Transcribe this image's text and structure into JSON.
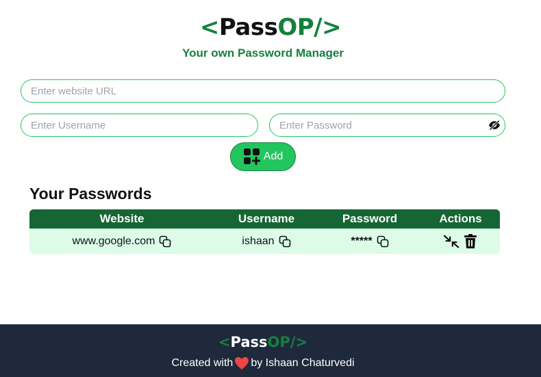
{
  "header": {
    "brand": {
      "lt": "<",
      "pass": "Pass",
      "op": "OP/",
      "gt": ">"
    },
    "tagline": "Your own Password Manager"
  },
  "form": {
    "url_placeholder": "Enter website URL",
    "username_placeholder": "Enter Username",
    "password_placeholder": "Enter Password",
    "url_value": "",
    "username_value": "",
    "password_value": "",
    "eye_icon": "eye-off-icon",
    "add_label": "Add",
    "add_icon": "add-grid-icon"
  },
  "passwords": {
    "title": "Your Passwords",
    "columns": [
      "Website",
      "Username",
      "Password",
      "Actions"
    ],
    "rows": [
      {
        "website": "www.google.com",
        "username": "ishaan",
        "password": "*****"
      }
    ],
    "action_icons": [
      "edit-icon",
      "delete-icon"
    ],
    "copy_icon": "copy-icon"
  },
  "footer": {
    "brand": {
      "lt": "<",
      "pass": "Pass",
      "op": "OP/",
      "gt": ">"
    },
    "credit_prefix": "Created with",
    "credit_suffix": "by Ishaan Chaturvedi"
  },
  "colors": {
    "accent_green": "#15803d",
    "button_green": "#22c55e",
    "table_header": "#166534",
    "table_row": "#dcfce7",
    "footer_bg": "#1e293b",
    "heart": "#ef4444"
  }
}
